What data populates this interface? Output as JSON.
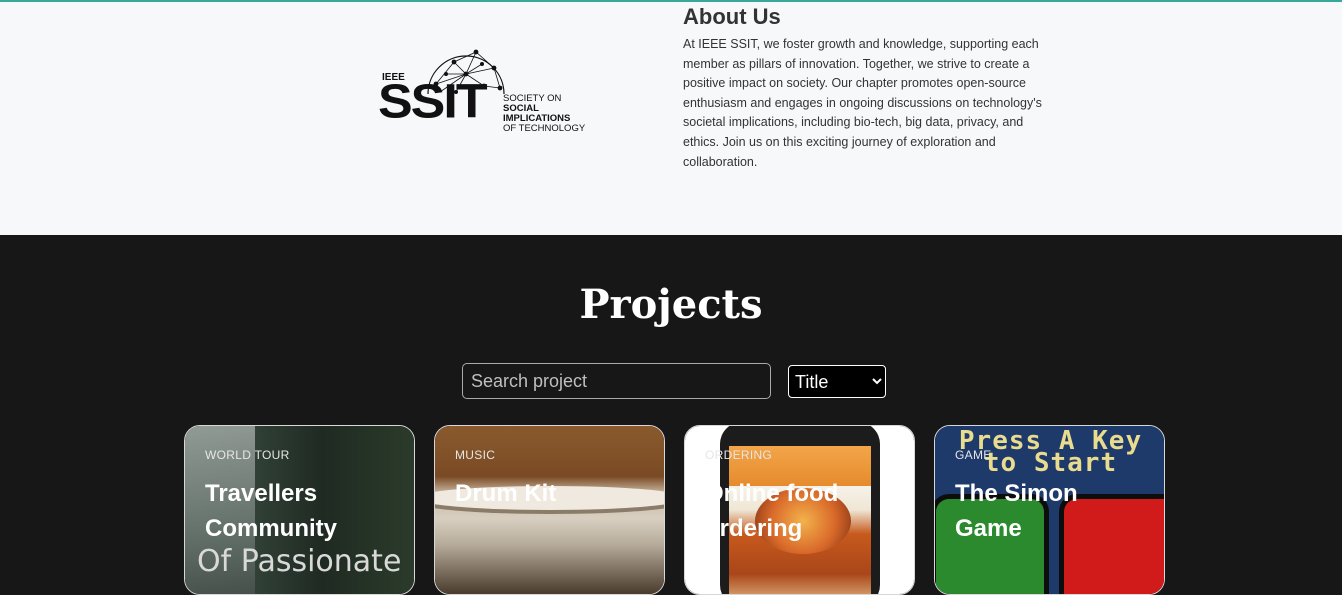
{
  "about": {
    "logo": {
      "ieee": "IEEE",
      "ssit": "SSIT",
      "line1": "SOCIETY ON",
      "line2": "SOCIAL IMPLICATIONS",
      "line3": "OF TECHNOLOGY"
    },
    "title": "About Us",
    "text": "At IEEE SSIT, we foster growth and knowledge, supporting each member as pillars of innovation. Together, we strive to create a positive impact on society. Our chapter promotes open-source enthusiasm and engages in ongoing discussions on technology's societal implications, including bio-tech, big data, privacy, and ethics. Join us on this exciting journey of exploration and collaboration."
  },
  "projects": {
    "title": "Projects",
    "search_placeholder": "Search project",
    "sort_selected": "Title",
    "cards": [
      {
        "category": "WORLD TOUR",
        "title": "Travellers Community",
        "image_text": "Of Passionate"
      },
      {
        "category": "MUSIC",
        "title": "Drum Kit"
      },
      {
        "category": "ORDERING",
        "title": "Online food ordering"
      },
      {
        "category": "GAME",
        "title": "The Simon Game",
        "image_text": "Press A Key to Start"
      }
    ]
  },
  "colors": {
    "accent_line": "#3aa79d",
    "dark_bg": "#171717",
    "light_bg": "#f7f8fa"
  }
}
